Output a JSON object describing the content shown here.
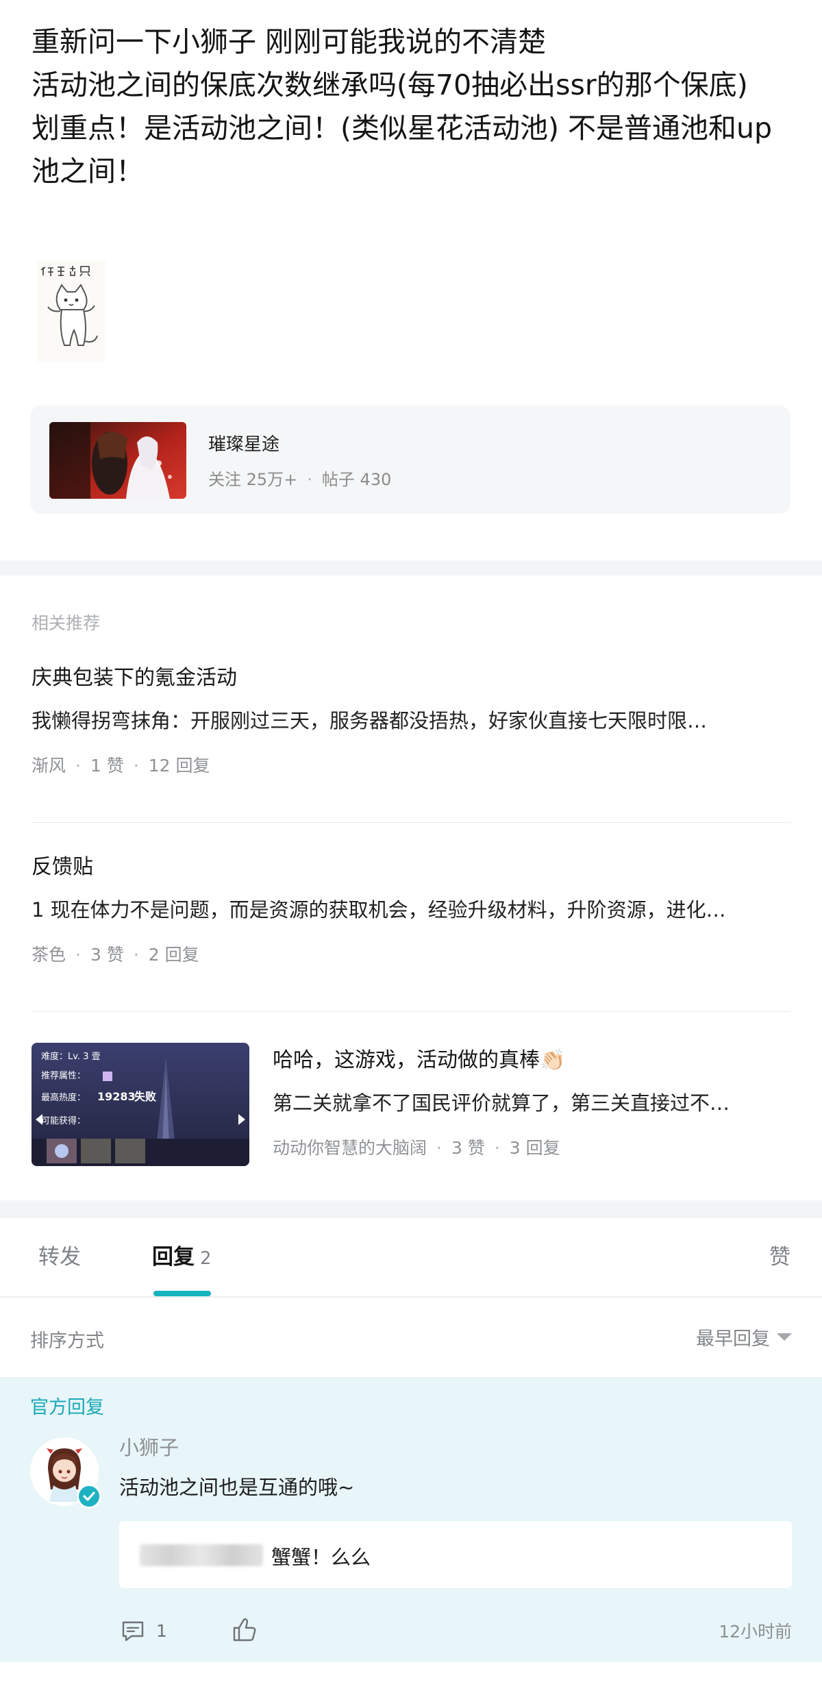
{
  "post": {
    "lines": [
      "重新问一下小狮子 刚刚可能我说的不清楚",
      "活动池之间的保底次数继承吗(每70抽必出ssr的那个保底)",
      "划重点！是活动池之间！(类似星花活动池) 不是普通池和up池之间！"
    ],
    "sticker_text": "祈求出货"
  },
  "forum": {
    "name": "璀璨星途",
    "followers": "关注 25万+",
    "separator": "·",
    "posts": "帖子 430"
  },
  "recommendations": {
    "heading": "相关推荐",
    "items": [
      {
        "title": "庆典包装下的氪金活动",
        "excerpt": "我懒得拐弯抹角：开服刚过三天，服务器都没捂热，好家伙直接七天限时限…",
        "author": "渐风",
        "likes": "1 赞",
        "replies": "12 回复"
      },
      {
        "title": "反馈贴",
        "excerpt": "1 现在体力不是问题，而是资源的获取机会，经验升级材料，升阶资源，进化…",
        "author": "茶色",
        "likes": "3 赞",
        "replies": "2 回复"
      },
      {
        "title": "哈哈，这游戏，活动做的真棒👏🏻",
        "excerpt": "第二关就拿不了国民评价就算了，第三关直接过不…",
        "author": "动动你智慧的大脑阔",
        "likes": "3 赞",
        "replies": "3 回复",
        "thumb": {
          "difficulty": "难度：Lv. 3 壹",
          "recommend_attr": "推荐属性：",
          "max_heat_label": "最高热度：",
          "max_heat_value": "19283",
          "result": "失败",
          "rewards": "可能获得："
        }
      }
    ]
  },
  "tabs": {
    "repost": "转发",
    "reply": "回复",
    "reply_count": "2",
    "like": "赞"
  },
  "sort": {
    "label": "排序方式",
    "value": "最早回复"
  },
  "official_reply": {
    "label": "官方回复",
    "author": "小狮子",
    "content": "活动池之间也是互通的哦~",
    "sub_reply_text": "蟹蟹！么么",
    "comment_count": "1",
    "time": "12小时前"
  },
  "colors": {
    "accent": "#17b3c0",
    "official_bg": "#e8f5f9"
  }
}
